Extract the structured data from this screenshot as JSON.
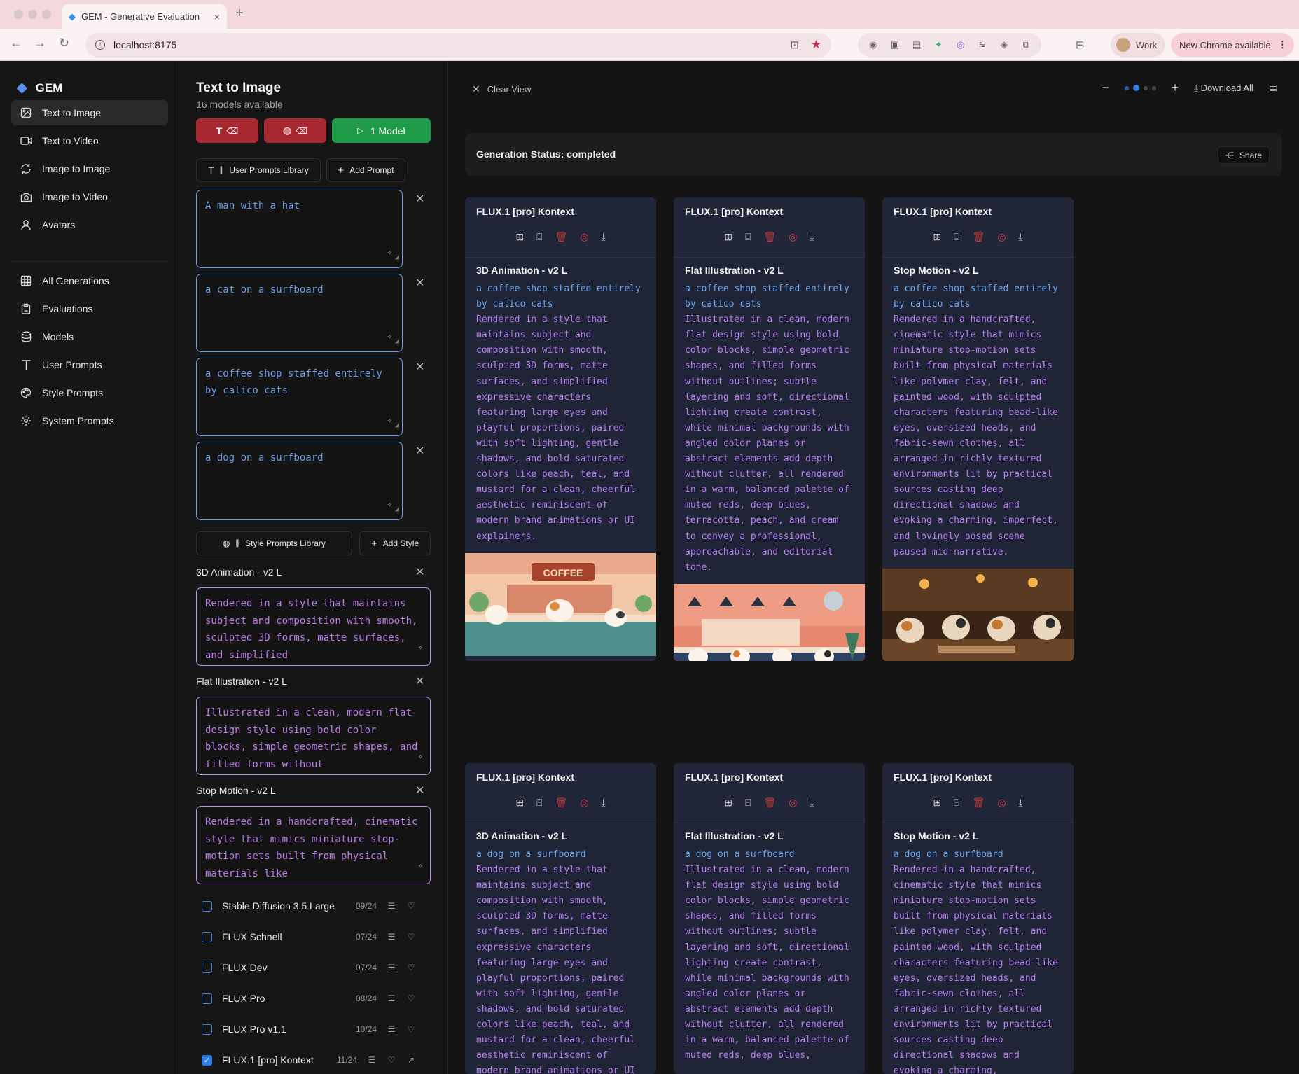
{
  "browser": {
    "tab_title": "GEM - Generative Evaluation",
    "tab_close": "×",
    "new_tab": "+",
    "url": "localhost:8175",
    "profile_label": "Work",
    "update_label": "New Chrome available"
  },
  "sidebar": {
    "brand": "GEM",
    "items": [
      {
        "label": "Text to Image",
        "icon": "image-icon"
      },
      {
        "label": "Text to Video",
        "icon": "video-icon"
      },
      {
        "label": "Image to Image",
        "icon": "refresh-icon"
      },
      {
        "label": "Image to Video",
        "icon": "camera-icon"
      },
      {
        "label": "Avatars",
        "icon": "user-icon"
      },
      {
        "label": "All Generations",
        "icon": "grid-icon"
      },
      {
        "label": "Evaluations",
        "icon": "clipboard-icon"
      },
      {
        "label": "Models",
        "icon": "database-icon"
      },
      {
        "label": "User Prompts",
        "icon": "text-icon"
      },
      {
        "label": "Style Prompts",
        "icon": "palette-icon"
      },
      {
        "label": "System Prompts",
        "icon": "gear-icon"
      }
    ]
  },
  "panel": {
    "title": "Text to Image",
    "subtitle": "16 models available",
    "run_label": "1 Model",
    "user_library_label": "User Prompts Library",
    "add_prompt_label": "Add Prompt",
    "style_library_label": "Style Prompts Library",
    "add_style_label": "Add Style",
    "prompts": [
      "A man with a hat",
      "a cat on a surfboard",
      "a coffee shop staffed entirely by calico cats",
      "a dog on a surfboard"
    ],
    "styles": [
      {
        "name": "3D Animation - v2 L",
        "text": "Rendered in a style that maintains subject and composition with smooth, sculpted 3D forms, matte surfaces, and simplified"
      },
      {
        "name": "Flat Illustration - v2 L",
        "text": "Illustrated in a clean, modern flat design style using bold color blocks, simple geometric shapes, and filled forms without"
      },
      {
        "name": "Stop Motion - v2 L",
        "text": "Rendered in a handcrafted, cinematic style that mimics miniature stop-motion sets built from physical materials like"
      }
    ],
    "models": [
      {
        "name": "Stable Diffusion 3.5 Large",
        "date": "09/24",
        "checked": false
      },
      {
        "name": "FLUX Schnell",
        "date": "07/24",
        "checked": false
      },
      {
        "name": "FLUX Dev",
        "date": "07/24",
        "checked": false
      },
      {
        "name": "FLUX Pro",
        "date": "08/24",
        "checked": false
      },
      {
        "name": "FLUX Pro v1.1",
        "date": "10/24",
        "checked": false
      },
      {
        "name": "FLUX.1 [pro] Kontext",
        "date": "11/24",
        "checked": true
      }
    ]
  },
  "main": {
    "clear_view": "Clear View",
    "download_all": "Download All",
    "status": "Generation Status: completed",
    "share": "Share",
    "cards": [
      {
        "model": "FLUX.1 [pro] Kontext",
        "style": "3D Animation - v2 L",
        "prompt": "a coffee shop staffed entirely by calico cats",
        "text": "Rendered in a style that maintains subject and composition with smooth, sculpted 3D forms, matte surfaces, and simplified expressive characters featuring large eyes and playful proportions, paired with soft lighting, gentle shadows, and bold saturated colors like peach, teal, and mustard for a clean, cheerful aesthetic reminiscent of modern brand animations or UI explainers.",
        "image_label": "COFFEE"
      },
      {
        "model": "FLUX.1 [pro] Kontext",
        "style": "Flat Illustration - v2 L",
        "prompt": "a coffee shop staffed entirely by calico cats",
        "text": "Illustrated in a clean, modern flat design style using bold color blocks, simple geometric shapes, and filled forms without outlines; subtle layering and soft, directional lighting create contrast, while minimal backgrounds with angled color planes or abstract elements add depth without clutter, all rendered in a warm, balanced palette of muted reds, deep blues, terracotta, peach, and cream to convey a professional, approachable, and editorial tone.",
        "image_label": ""
      },
      {
        "model": "FLUX.1 [pro] Kontext",
        "style": "Stop Motion - v2 L",
        "prompt": "a coffee shop staffed entirely by calico cats",
        "text": "Rendered in a handcrafted, cinematic style that mimics miniature stop-motion sets built from physical materials like polymer clay, felt, and painted wood, with sculpted characters featuring bead-like eyes, oversized heads, and fabric-sewn clothes, all arranged in richly textured environments lit by practical sources casting deep directional shadows and evoking a charming, imperfect, and lovingly posed scene paused mid-narrative.",
        "image_label": ""
      },
      {
        "model": "FLUX.1 [pro] Kontext",
        "style": "3D Animation - v2 L",
        "prompt": "a dog on a surfboard",
        "text": "Rendered in a style that maintains subject and composition with smooth, sculpted 3D forms, matte surfaces, and simplified expressive characters featuring large eyes and playful proportions, paired with soft lighting, gentle shadows, and bold saturated colors like peach, teal, and mustard for a clean, cheerful aesthetic reminiscent of modern brand animations or UI",
        "image_label": ""
      },
      {
        "model": "FLUX.1 [pro] Kontext",
        "style": "Flat Illustration - v2 L",
        "prompt": "a dog on a surfboard",
        "text": "Illustrated in a clean, modern flat design style using bold color blocks, simple geometric shapes, and filled forms without outlines; subtle layering and soft, directional lighting create contrast, while minimal backgrounds with angled color planes or abstract elements add depth without clutter, all rendered in a warm, balanced palette of muted reds, deep blues,",
        "image_label": ""
      },
      {
        "model": "FLUX.1 [pro] Kontext",
        "style": "Stop Motion - v2 L",
        "prompt": "a dog on a surfboard",
        "text": "Rendered in a handcrafted, cinematic style that mimics miniature stop-motion sets built from physical materials like polymer clay, felt, and painted wood, with sculpted characters featuring bead-like eyes, oversized heads, and fabric-sewn clothes, all arranged in richly textured environments lit by practical sources casting deep directional shadows and evoking a charming,",
        "image_label": ""
      }
    ]
  },
  "colors": {
    "accent_blue": "#2f7de0",
    "run_green": "#1f9a47",
    "clear_red": "#a82830",
    "prompt_blue": "#6aa4ee",
    "style_purple": "#b67cf0"
  }
}
